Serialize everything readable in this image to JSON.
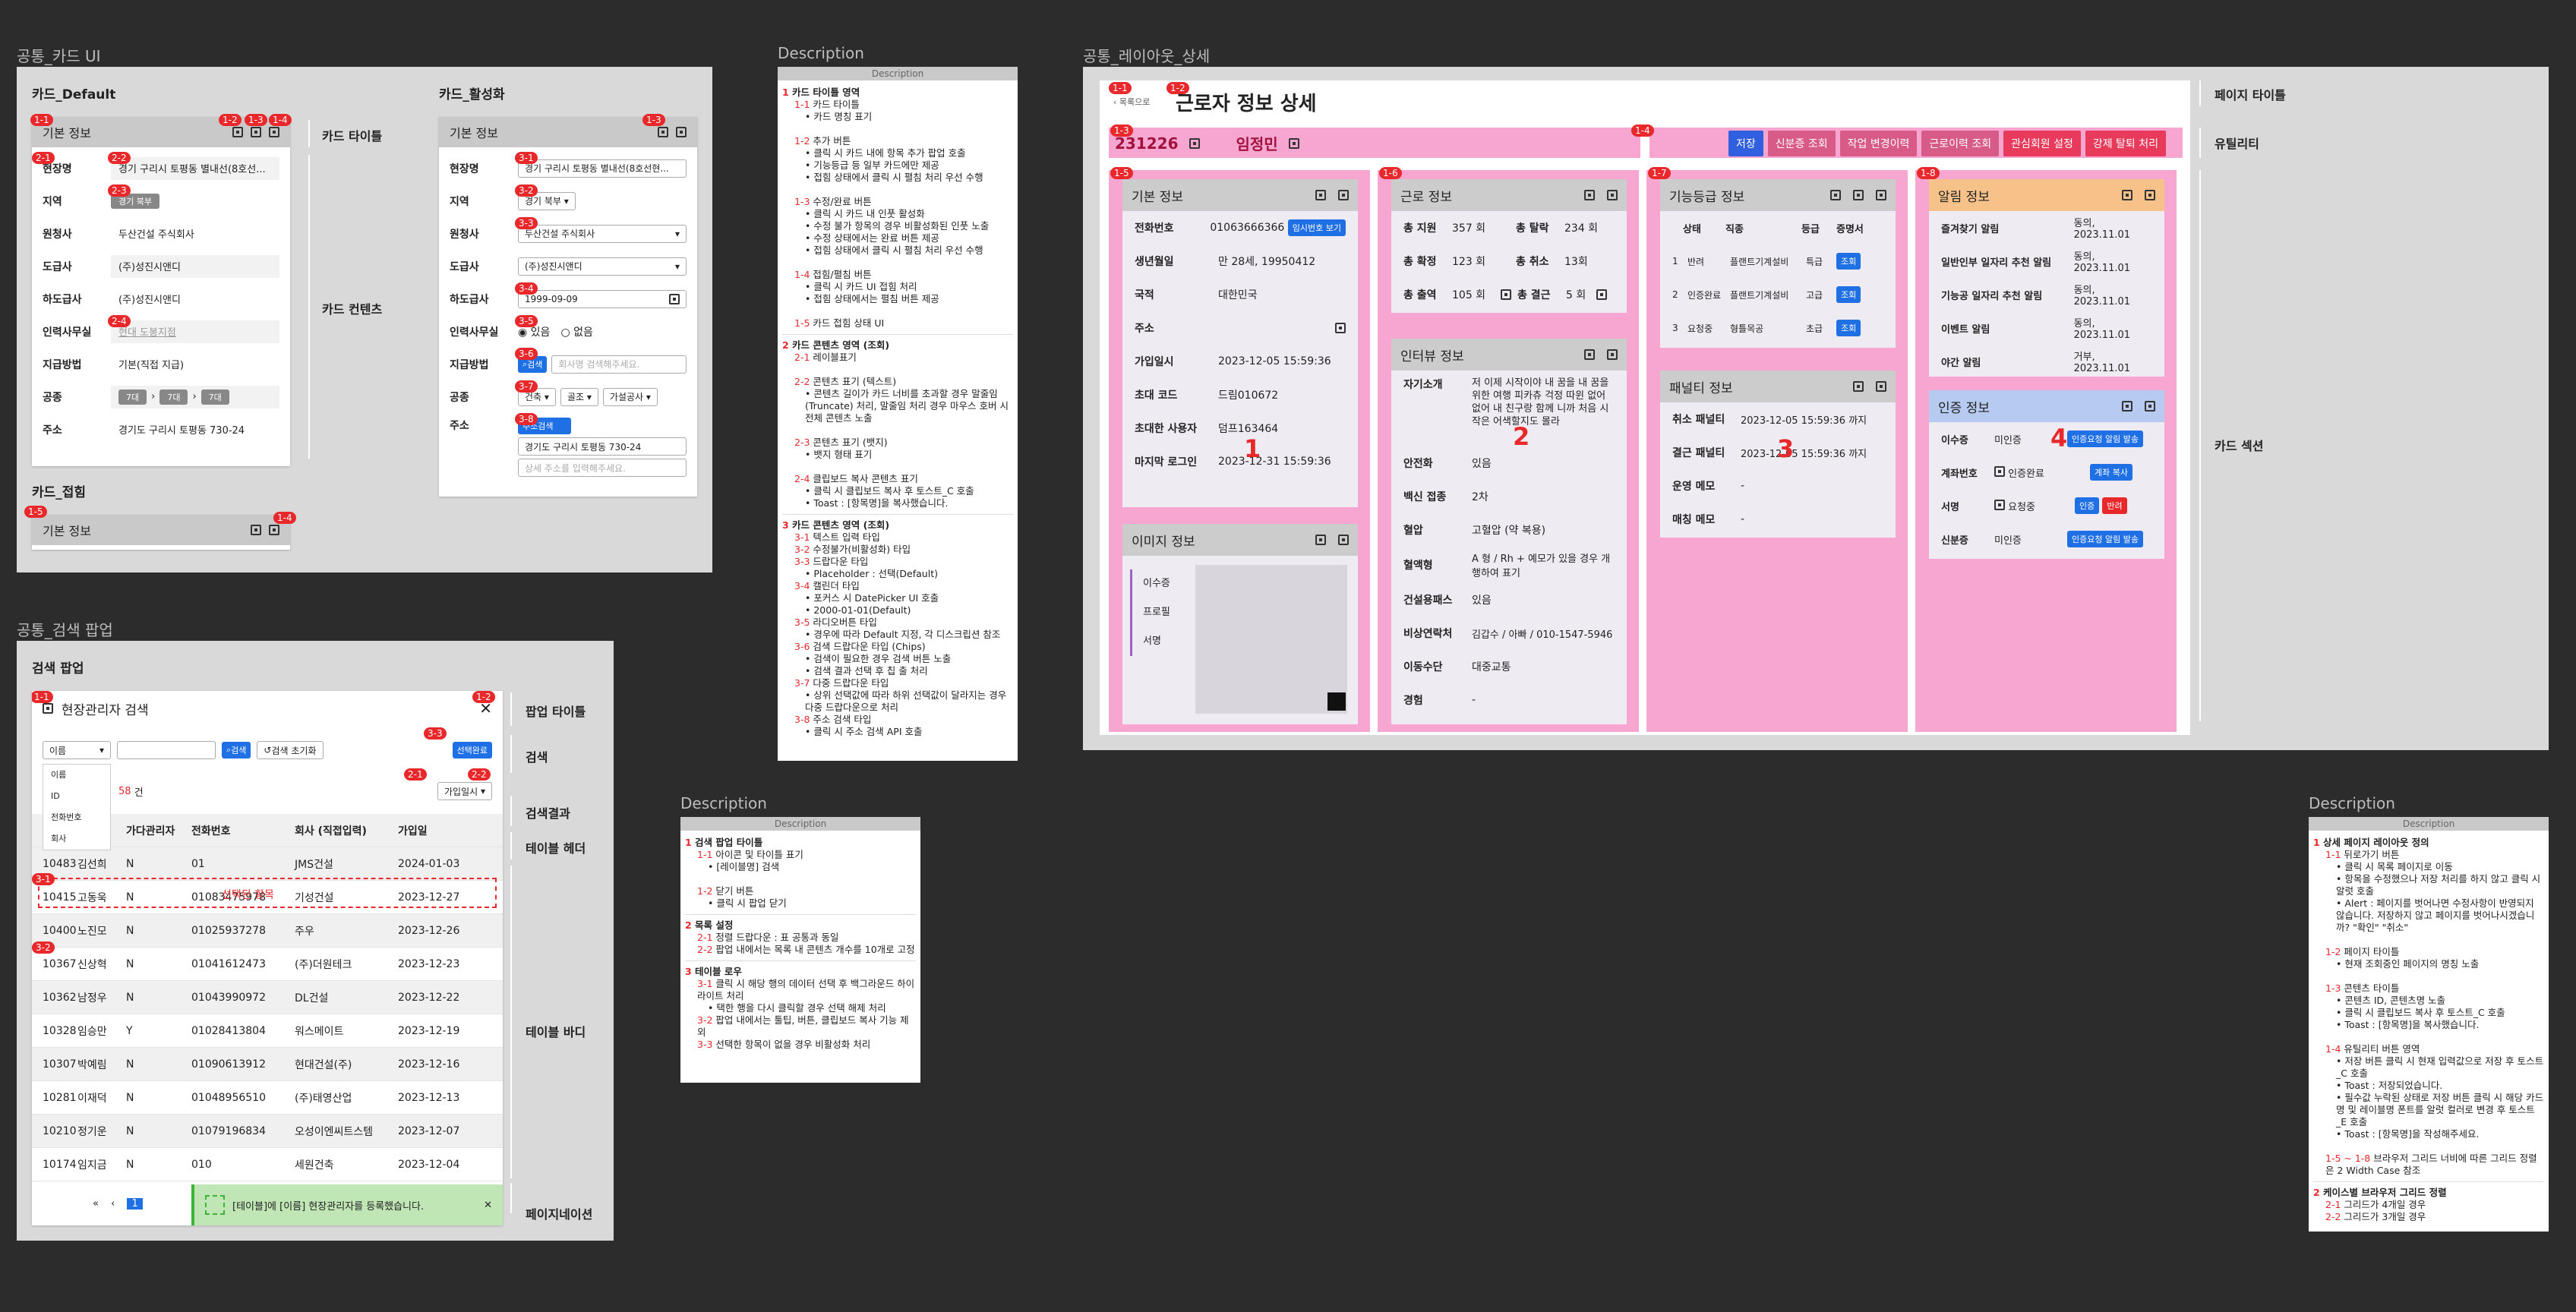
{
  "frames": {
    "card": "공통_카드 UI",
    "search": "공통_검색 팝업",
    "layout": "공통_레이아웃_상세"
  },
  "cardui": {
    "default_label": "카드_Default",
    "active_label": "카드_활성화",
    "collapsed_label": "카드_접힘",
    "card_title": "기본 정보",
    "rows": [
      {
        "k": "현장명",
        "v": "경기 구리시 토평동 별내선(8호선..."
      },
      {
        "k": "지역",
        "v": "경기 북부"
      },
      {
        "k": "원청사",
        "v": "두산건설 주식회사"
      },
      {
        "k": "도급사",
        "v": "(주)성진시앤디"
      },
      {
        "k": "하도급사",
        "v": "(주)성진시앤디"
      },
      {
        "k": "인력사무실",
        "v": "현대 도봉지점"
      },
      {
        "k": "지급방법",
        "v": "기본(직접 지급)"
      },
      {
        "k": "공종",
        "v": ""
      },
      {
        "k": "주소",
        "v": "경기도 구리시 토평동 730-24"
      }
    ],
    "chips": [
      "7대",
      "7대",
      "7대"
    ],
    "active_rows": [
      {
        "k": "현장명",
        "v": "경기 구리시 토평동 별내선(8호선현..."
      },
      {
        "k": "지역",
        "v": "경기 북부"
      },
      {
        "k": "원청사",
        "v": "두산건설 주식회사"
      },
      {
        "k": "도급사",
        "v": "(주)성진시앤디"
      },
      {
        "k": "하도급사",
        "v": "1999-09-09"
      },
      {
        "k": "인력사무실",
        "v": ""
      },
      {
        "k": "지급방법",
        "v": ""
      },
      {
        "k": "공종",
        "v": ""
      },
      {
        "k": "주소",
        "v": ""
      }
    ],
    "radio_yes": "있음",
    "radio_no": "없음",
    "search_btn": "검색",
    "search_ph": "회사명 검색해주세요.",
    "gong1": "건축",
    "gong2": "골조",
    "gong3": "가설공사",
    "addr_btn": "주소검색",
    "addr1": "경기도 구리시 토평동 730-24",
    "addr2": "상세 주소를 입력해주세요.",
    "title_label": "카드 타이틀",
    "content_label": "카드 컨텐츠"
  },
  "search": {
    "label": "검색 팝업",
    "title": "현장관리자 검색",
    "select": "이름",
    "opts": [
      "이름",
      "ID",
      "전화번호",
      "회사"
    ],
    "search_btn": "검색",
    "reset_btn": "검색 초기화",
    "done_btn": "선택완료",
    "count": "58",
    "count_unit": "건",
    "sort": "가입일시",
    "cols": [
      "ID",
      "이름",
      "가다관리자",
      "전화번호",
      "회사 (직접입력)",
      "가입일"
    ],
    "rows": [
      [
        "10483",
        "김선희",
        "N",
        "01",
        "JMS건설",
        "2024-01-03"
      ],
      [
        "10415",
        "고동욱",
        "N",
        "01083475978",
        "기성건설",
        "2023-12-27"
      ],
      [
        "10400",
        "노진모",
        "N",
        "01025937278",
        "주우",
        "2023-12-26"
      ],
      [
        "10367",
        "신상혁",
        "N",
        "01041612473",
        "(주)더원테크",
        "2023-12-23"
      ],
      [
        "10362",
        "남정우",
        "N",
        "01043990972",
        "DL건설",
        "2023-12-22"
      ],
      [
        "10328",
        "임승만",
        "Y",
        "01028413804",
        "워스메이트",
        "2023-12-19"
      ],
      [
        "10307",
        "박예림",
        "N",
        "01090613912",
        "현대건설(주)",
        "2023-12-16"
      ],
      [
        "10281",
        "이재덕",
        "N",
        "01048956510",
        "(주)태영산업",
        "2023-12-13"
      ],
      [
        "10210",
        "정기운",
        "N",
        "01079196834",
        "오성이엔씨트스템",
        "2023-12-07"
      ],
      [
        "10174",
        "임지금",
        "N",
        "010",
        "세원건축",
        "2023-12-04"
      ]
    ],
    "row_overlay": "선택된 항목",
    "toast": "[테이블]에 [이름] 현장관리자를 등록했습니다.",
    "labels": [
      "팝업 타이틀",
      "검색",
      "검색결과",
      "테이블 헤더",
      "테이블 바디",
      "페이지네이션"
    ],
    "page": "1"
  },
  "layout": {
    "back": "목록으로",
    "title": "근로자 정보 상세",
    "id": "231226",
    "name": "임정민",
    "buttons": [
      "저장",
      "신분증 조회",
      "작업 변경이력",
      "근로이력 조회",
      "관심회원 설정",
      "강제 탈퇴 처리"
    ],
    "labels": [
      "페이지 타이틀",
      "유틸리티",
      "카드 섹션"
    ],
    "basic": {
      "title": "기본 정보",
      "rows": [
        [
          "전화번호",
          "01063666366"
        ],
        [
          "생년월일",
          "만 28세, 19950412"
        ],
        [
          "국적",
          "대한민국"
        ],
        [
          "주소",
          ""
        ],
        [
          "가입일시",
          "2023-12-05 15:59:36"
        ],
        [
          "초대 코드",
          "드림010672"
        ],
        [
          "초대한 사용자",
          "덤프163464"
        ],
        [
          "마지막 로그인",
          "2023-12-31 15:59:36"
        ]
      ],
      "call_btn": "임시번호 보기"
    },
    "work": {
      "title": "근로 정보",
      "r1": [
        "총 지원",
        "357 회",
        "총 탈락",
        "234 회"
      ],
      "r2": [
        "총 확정",
        "123 회",
        "총 취소",
        "13회"
      ],
      "r3": [
        "총 출역",
        "105 회",
        "총 결근",
        "5 회"
      ]
    },
    "interview": {
      "title": "인터뷰 정보",
      "rows": [
        [
          "자기소개",
          "저 이제 시작이야 내 꿈을 내 꿈을 위한 여행 피카츄 걱정 따윈 없어 없어 내 친구랑 함께 니까 처음 시작은 어색할지도 몰라"
        ],
        [
          "안전화",
          "있음"
        ],
        [
          "백신 접종",
          "2차"
        ],
        [
          "혈압",
          "고혈압 (약 복용)"
        ],
        [
          "혈액형",
          "A 형 / Rh + 예모가 있을 경우 개행하여 표기"
        ],
        [
          "건설용패스",
          "있음"
        ],
        [
          "비상연락처",
          "김갑수 / 아빠 / 010-1547-5946"
        ],
        [
          "이동수단",
          "대중교통"
        ],
        [
          "경험",
          "-"
        ]
      ]
    },
    "image": {
      "title": "이미지 정보",
      "tabs": [
        "이수증",
        "프로필",
        "서명"
      ]
    },
    "skill": {
      "title": "기능등급 정보",
      "cols": [
        "상태",
        "직종",
        "등급",
        "증명서"
      ],
      "rows": [
        [
          "1",
          "반려",
          "플랜트기계설비",
          "특급"
        ],
        [
          "2",
          "인증완료",
          "플랜트기계설비",
          "고급"
        ],
        [
          "3",
          "요청중",
          "형틀목공",
          "초급"
        ]
      ],
      "btn": "조회"
    },
    "penalty": {
      "title": "패널티 정보",
      "rows": [
        [
          "취소 패널티",
          "2023-12-05 15:59:36 까지"
        ],
        [
          "결근 패널티",
          "2023-12-05 15:59:36 까지"
        ],
        [
          "운영 메모",
          "-"
        ],
        [
          "매칭 메모",
          "-"
        ]
      ]
    },
    "alarm": {
      "title": "알림 정보",
      "rows": [
        [
          "즐겨찾기 알림",
          "동의, 2023.11.01"
        ],
        [
          "일반인부 일자리 추천 알림",
          "동의, 2023.11.01"
        ],
        [
          "기능공 일자리 추천 알림",
          "동의, 2023.11.01"
        ],
        [
          "이벤트 알림",
          "동의, 2023.11.01"
        ],
        [
          "야간 알림",
          "거부, 2023.11.01"
        ]
      ]
    },
    "cert": {
      "title": "인증 정보",
      "rows": [
        [
          "이수증",
          "미인증",
          "인증요청 알림 발송"
        ],
        [
          "계좌번호",
          "인증완료",
          "계좌 복사"
        ],
        [
          "서명",
          "요청중",
          "인증",
          "반려"
        ],
        [
          "신분증",
          "미인증",
          "인증요청 알림 발송"
        ]
      ]
    },
    "nums": [
      "1",
      "2",
      "3",
      "4"
    ]
  },
  "desc_title": "Description"
}
